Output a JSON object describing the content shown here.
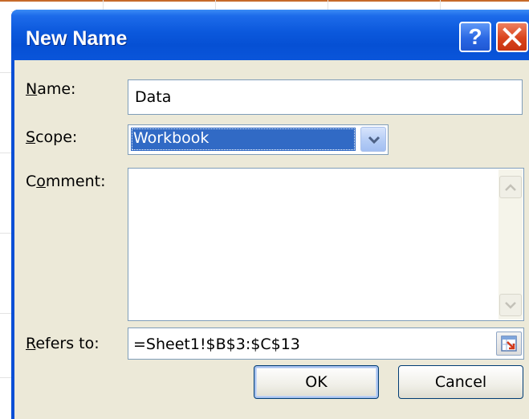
{
  "dialog": {
    "title": "New Name",
    "help_label": "?"
  },
  "fields": {
    "name": {
      "label_key": "N",
      "label_rest": "ame:",
      "value": "Data"
    },
    "scope": {
      "label_key": "S",
      "label_rest": "cope:",
      "value": "Workbook"
    },
    "comment": {
      "label_pre": "C",
      "label_key": "o",
      "label_rest": "mment:",
      "value": ""
    },
    "refers_to": {
      "label_key": "R",
      "label_rest": "efers to:",
      "value": "=Sheet1!$B$3:$C$13"
    }
  },
  "buttons": {
    "ok": "OK",
    "cancel": "Cancel"
  },
  "colors": {
    "titlebar": "#0650d4",
    "selection": "#316ac5",
    "client": "#ece9d8",
    "close": "#d9431c"
  }
}
